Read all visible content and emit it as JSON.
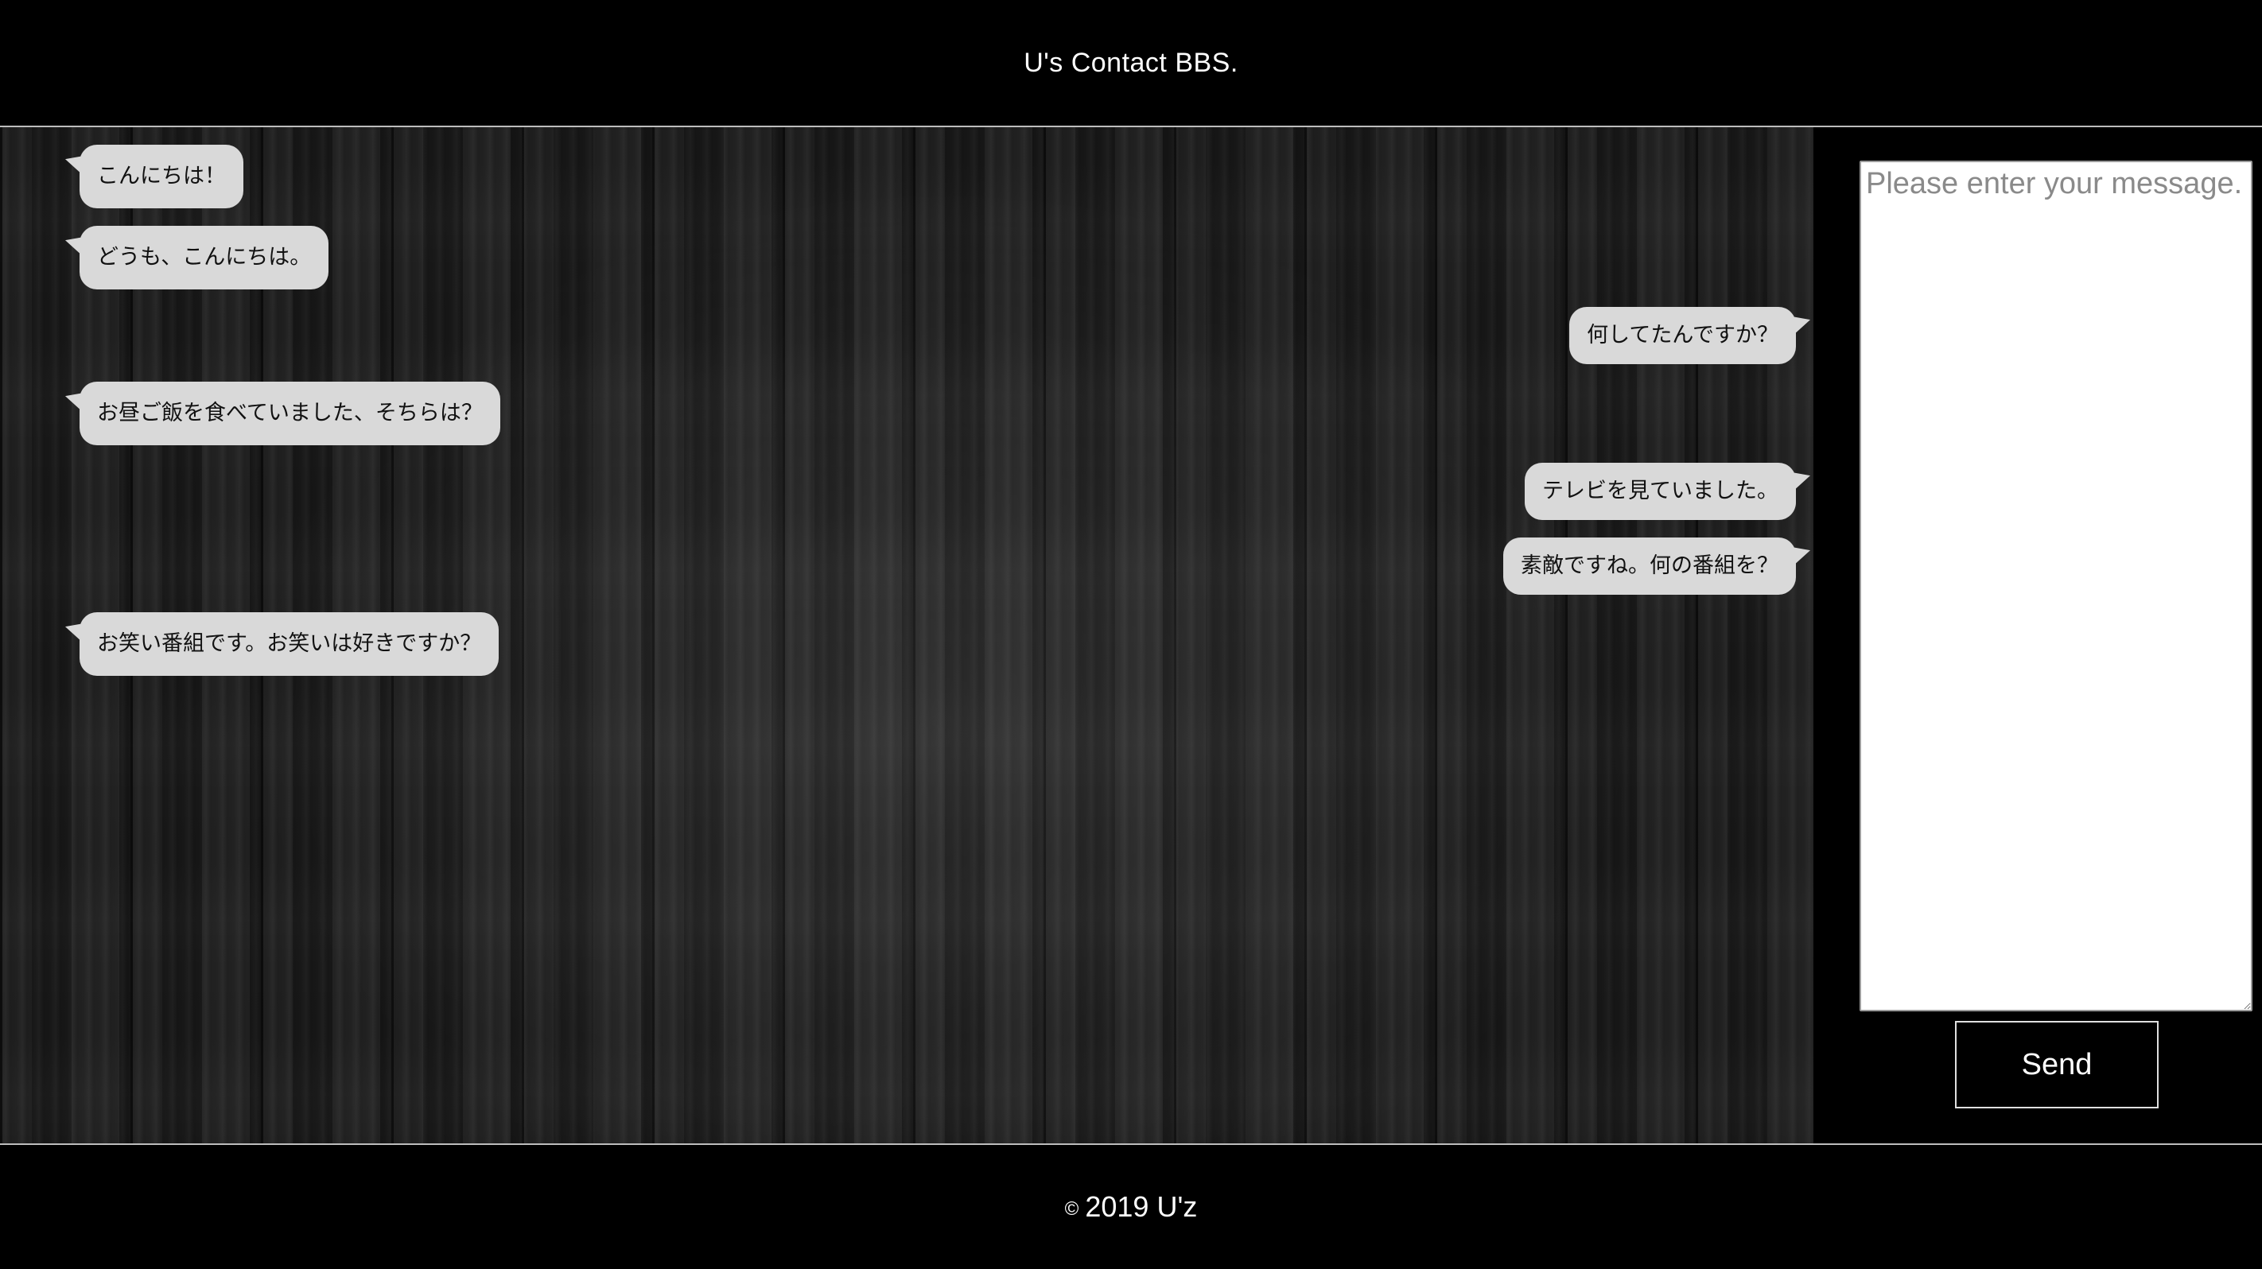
{
  "header": {
    "title": "U's Contact BBS."
  },
  "chat": {
    "messages": [
      {
        "side": "left",
        "text": "こんにちは！"
      },
      {
        "side": "left",
        "text": "どうも、こんにちは。"
      },
      {
        "side": "right",
        "text": "何してたんですか？"
      },
      {
        "side": "left",
        "text": "お昼ご飯を食べていました、そちらは？"
      },
      {
        "side": "right",
        "text": "テレビを見ていました。"
      },
      {
        "side": "right",
        "text": "素敵ですね。何の番組を？"
      },
      {
        "side": "left",
        "text": "お笑い番組です。お笑いは好きですか？"
      }
    ]
  },
  "composer": {
    "placeholder": "Please enter your message.",
    "value": "",
    "send_label": "Send"
  },
  "footer": {
    "copyright_symbol": "©",
    "text": "2019 U'z"
  },
  "colors": {
    "page_background": "#000000",
    "bubble": "#d9d9d9",
    "divider": "#bdbdbd"
  }
}
